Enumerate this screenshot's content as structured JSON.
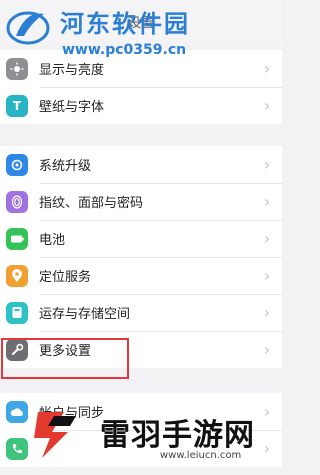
{
  "header": {
    "title": "设置"
  },
  "watermark_top": {
    "name": "河东软件园",
    "url": "www.pc0359.cn"
  },
  "groups": [
    {
      "items": [
        {
          "label": "显示与亮度",
          "icon": "brightness-icon",
          "color": "#8e8e93"
        },
        {
          "label": "壁纸与字体",
          "icon": "font-icon",
          "color": "#27b4c4"
        }
      ]
    },
    {
      "items": [
        {
          "label": "系统升级",
          "icon": "system-update-icon",
          "color": "#2f88e8"
        },
        {
          "label": "指纹、面部与密码",
          "icon": "fingerprint-icon",
          "color": "#a072e0"
        },
        {
          "label": "电池",
          "icon": "battery-icon",
          "color": "#35c257"
        },
        {
          "label": "定位服务",
          "icon": "location-icon",
          "color": "#f0a030"
        },
        {
          "label": "运存与存储空间",
          "icon": "storage-icon",
          "color": "#2ec2c6"
        },
        {
          "label": "更多设置",
          "icon": "wrench-icon",
          "color": "#6d6d72"
        }
      ]
    },
    {
      "items": [
        {
          "label": "帐户与同步",
          "icon": "account-sync-icon",
          "color": "#3fa7e6"
        },
        {
          "label": "",
          "icon": "phone-icon",
          "color": "#3fc47b"
        }
      ]
    }
  ],
  "watermark_bottom": {
    "name": "雷羽手游网",
    "url": "www.leiucn.com"
  },
  "highlight_color": "#e0383e"
}
